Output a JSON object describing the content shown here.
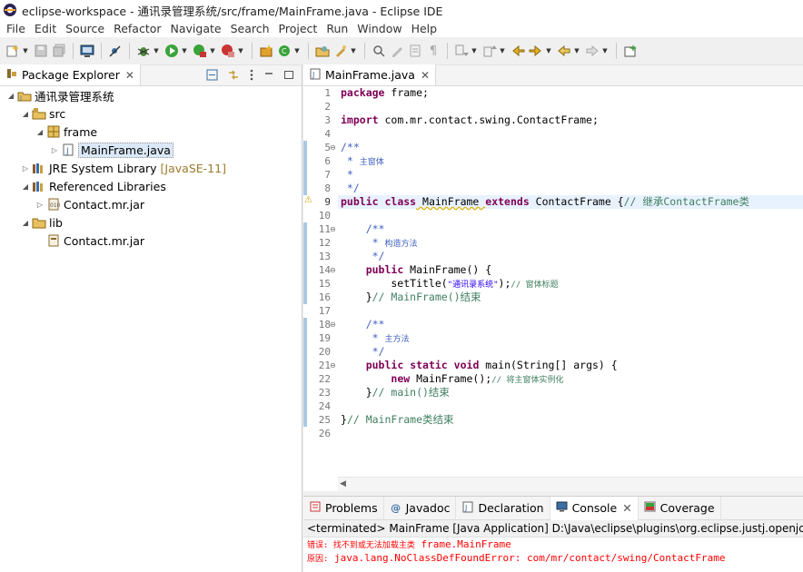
{
  "window": {
    "title": "eclipse-workspace - 通讯录管理系统/src/frame/MainFrame.java - Eclipse IDE"
  },
  "menu": [
    "File",
    "Edit",
    "Source",
    "Refactor",
    "Navigate",
    "Search",
    "Project",
    "Run",
    "Window",
    "Help"
  ],
  "package_explorer": {
    "tab_label": "Package Explorer",
    "tree": [
      {
        "label": "通讯录管理系统",
        "icon": "java-project-icon",
        "expand": "open"
      },
      {
        "label": "src",
        "icon": "source-folder-icon",
        "expand": "open"
      },
      {
        "label": "frame",
        "icon": "package-icon",
        "expand": "open"
      },
      {
        "label": "MainFrame.java",
        "icon": "java-file-icon",
        "expand": "closed"
      },
      {
        "label": "JRE System Library",
        "decor": "[JavaSE-11]",
        "icon": "library-icon",
        "expand": "closed"
      },
      {
        "label": "Referenced Libraries",
        "icon": "library-icon",
        "expand": "open"
      },
      {
        "label": "Contact.mr.jar",
        "icon": "jar-icon",
        "expand": "closed"
      },
      {
        "label": "lib",
        "icon": "folder-icon",
        "expand": "open"
      },
      {
        "label": "Contact.mr.jar",
        "icon": "jar-file-icon",
        "expand": "none"
      }
    ]
  },
  "editor": {
    "tab_label": "MainFrame.java",
    "line_numbers": [
      "1",
      "2",
      "3",
      "4",
      "5",
      "6",
      "7",
      "8",
      "9",
      "10",
      "11",
      "12",
      "13",
      "14",
      "15",
      "16",
      "17",
      "18",
      "19",
      "20",
      "21",
      "22",
      "23",
      "24",
      "25",
      "26"
    ],
    "tokens": {
      "package": "package",
      "pkg_name": " frame;",
      "import": "import",
      "import_path": " com.mr.contact.swing.ContactFrame;",
      "doc_open": "/**",
      "doc_star": " * ",
      "doc_close": " */",
      "doc_blank": " *",
      "doc_main_window": "主窗体",
      "public": "public",
      "class": "class",
      "extends": "extends",
      "class_name": " MainFrame ",
      "super_name": " ContactFrame {",
      "comment_inherit": "// 继承ContactFrame类",
      "ctor_doc_open": "    /**",
      "ctor_doc_star": "     * ",
      "ctor_doc_close": "     */",
      "doc_ctor": "构造方法",
      "ctor_sig": " MainFrame() {",
      "settitle_call": "        setTitle(",
      "title_str": "\"通讯录系统\"",
      "settitle_end": ");",
      "comment_window_title": "// 窗体标题",
      "ctor_close": "    }",
      "comment_ctor_end": "// MainFrame()结束",
      "doc_main_method": "主方法",
      "static": "static",
      "void": "void",
      "main_sig": " main(String[] args) {",
      "new": "new",
      "new_expr": " MainFrame();",
      "comment_instantiate": "// 将主窗体实例化",
      "comment_main_end": "// main()结束",
      "class_close": "}",
      "comment_class_end": "// MainFrame类结束"
    }
  },
  "console": {
    "tabs": [
      {
        "label": "Problems",
        "icon": "problems-icon"
      },
      {
        "label": "Javadoc",
        "icon": "javadoc-icon"
      },
      {
        "label": "Declaration",
        "icon": "declaration-icon"
      },
      {
        "label": "Console",
        "icon": "console-icon"
      },
      {
        "label": "Coverage",
        "icon": "coverage-icon"
      }
    ],
    "header": "<terminated> MainFrame [Java Application] D:\\Java\\eclipse\\plugins\\org.eclipse.justj.openjdk.h",
    "error_prefix_1": "错误: 找不到或无法加载主类",
    "error_value_1": " frame.MainFrame",
    "error_prefix_2": "原因:",
    "error_value_2": " java.lang.NoClassDefFoundError: com/mr/contact/swing/ContactFrame"
  }
}
